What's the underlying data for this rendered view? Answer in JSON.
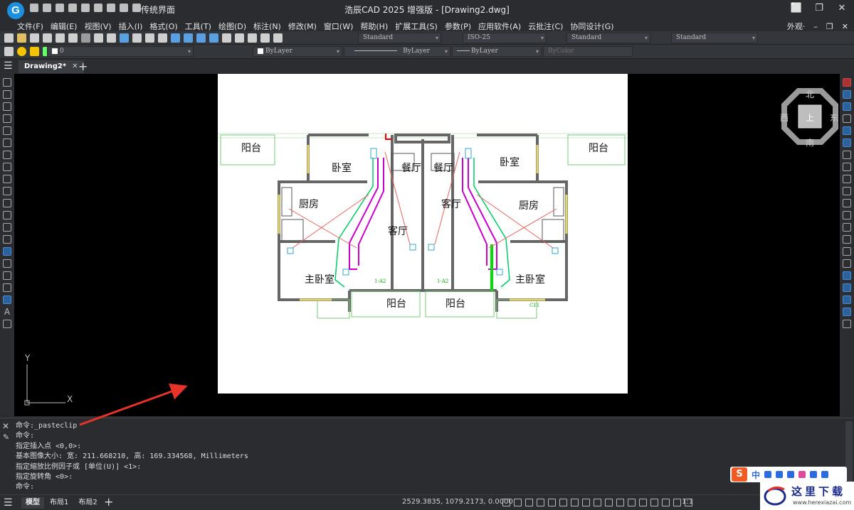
{
  "window": {
    "logo_letter": "G",
    "workspace": "传统界面",
    "title": "浩辰CAD 2025 增强版 - [Drawing2.dwg]",
    "controls": [
      "⬜",
      "❐",
      "✕"
    ]
  },
  "menus": [
    "文件(F)",
    "编辑(E)",
    "视图(V)",
    "插入(I)",
    "格式(O)",
    "工具(T)",
    "绘图(D)",
    "标注(N)",
    "修改(M)",
    "窗口(W)",
    "帮助(H)",
    "扩展工具(S)",
    "参数(P)",
    "应用软件(A)",
    "云批注(C)",
    "协同设计(G)"
  ],
  "menu_right": {
    "appearance": "外观·",
    "min": "–",
    "restore": "❐",
    "close": "✕"
  },
  "toolbar1": {
    "text_style": "Standard",
    "dim_style": "ISO-25",
    "table_style": "Standard",
    "multileader_style": "Standard"
  },
  "toolbar2": {
    "layer": "0",
    "color": "ByLayer",
    "linetype": "ByLayer",
    "lineweight": "ByLayer",
    "plotstyle": "ByColor"
  },
  "tabs": {
    "document": "Drawing2*",
    "close": "✕",
    "new": "+"
  },
  "drawing": {
    "rooms": {
      "balcony_tl": "阳台",
      "bedroom_l": "卧室",
      "dining_l": "餐厅",
      "dining_r": "餐厅",
      "bedroom_r": "卧室",
      "balcony_tr": "阳台",
      "kitchen_l": "厨房",
      "living_r": "客厅",
      "kitchen_r": "厨房",
      "living_l": "客厅",
      "master_l": "主卧室",
      "master_r": "主卧室",
      "balcony_bl": "阳台",
      "balcony_br": "阳台"
    },
    "tags": {
      "left": "1-A2",
      "right": "1-A2",
      "right_bottom": "C11"
    }
  },
  "viewcube": {
    "north": "北",
    "south": "南",
    "east": "东",
    "west": "西",
    "top": "上"
  },
  "ucs": {
    "y": "Y",
    "x": "X"
  },
  "command": {
    "lines": [
      "命令:_pasteclip",
      "命令:",
      "指定插入点 <0,0>:",
      "基本图像大小: 宽: 211.668210, 高: 169.334568, Millimeters",
      "指定缩放比例因子或 [单位(U)] <1>:",
      "指定旋转角 <0>:",
      "命令:"
    ]
  },
  "status": {
    "layout_tabs": [
      "模型",
      "布局1",
      "布局2"
    ],
    "add": "+",
    "coords": "2529.3835, 1079.2173, 0.0000",
    "scale": "1:1"
  },
  "ime": {
    "logo": "S",
    "lang": "中"
  },
  "watermark": {
    "text": "这里下载",
    "url": "www.herexiazai.com"
  },
  "colors": {
    "accent": "#1b8fe0",
    "canvas": "#000000",
    "paper": "#ffffff",
    "pipe_magenta": "#cc00cc",
    "pipe_green": "#00cc66",
    "annotation_red": "#e8332a"
  }
}
